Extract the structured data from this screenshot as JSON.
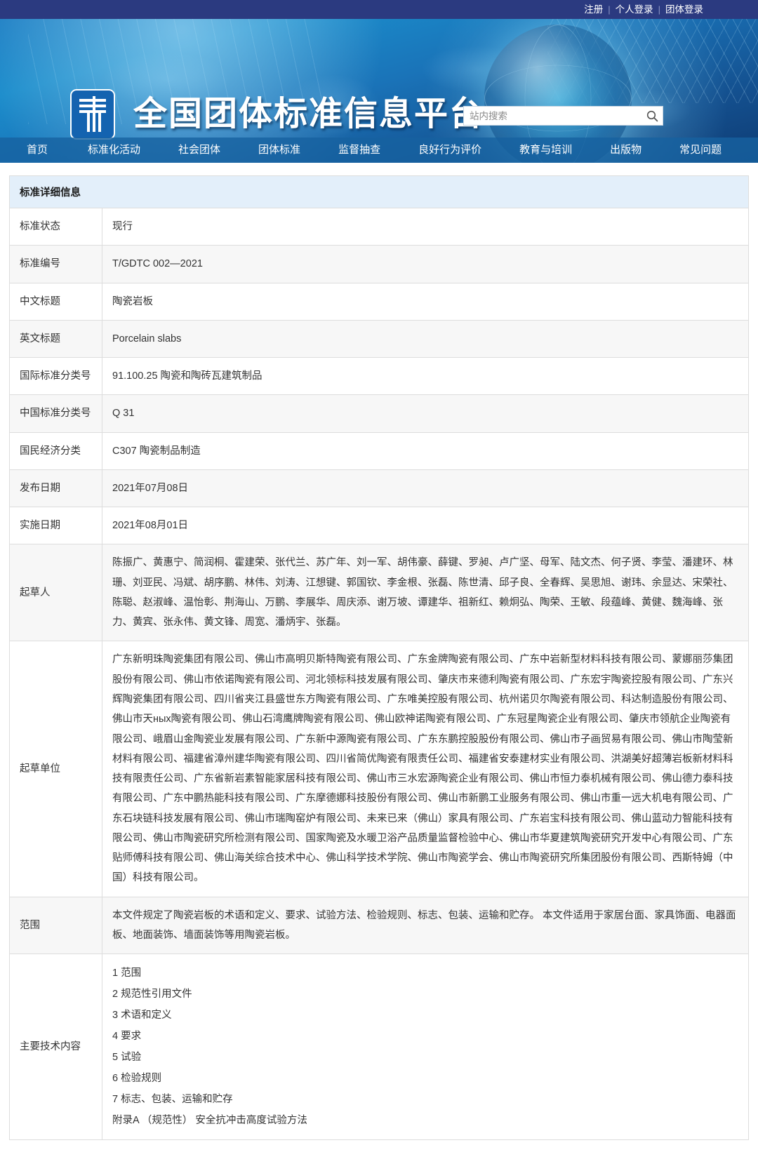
{
  "topbar": {
    "register": "注册",
    "personal_login": "个人登录",
    "group_login": "团体登录",
    "separator": "|"
  },
  "header": {
    "site_title": "全国团体标准信息平台",
    "logo_alt": "平台标识",
    "search": {
      "placeholder": "站内搜索",
      "value": "",
      "button_icon": "search-icon"
    }
  },
  "nav": {
    "items": [
      {
        "label": "首页"
      },
      {
        "label": "标准化活动"
      },
      {
        "label": "社会团体"
      },
      {
        "label": "团体标准"
      },
      {
        "label": "监督抽查"
      },
      {
        "label": "良好行为评价"
      },
      {
        "label": "教育与培训"
      },
      {
        "label": "出版物"
      },
      {
        "label": "常见问题"
      }
    ]
  },
  "detail": {
    "caption": "标准详细信息",
    "rows": [
      {
        "key": "标准状态",
        "value": "现行"
      },
      {
        "key": "标准编号",
        "value": "T/GDTC 002—2021"
      },
      {
        "key": "中文标题",
        "value": "陶瓷岩板"
      },
      {
        "key": "英文标题",
        "value": "Porcelain slabs"
      },
      {
        "key": "国际标准分类号",
        "value": "91.100.25 陶瓷和陶砖瓦建筑制品"
      },
      {
        "key": "中国标准分类号",
        "value": "Q 31"
      },
      {
        "key": "国民经济分类",
        "value": "C307 陶瓷制品制造"
      },
      {
        "key": "发布日期",
        "value": "2021年07月08日"
      },
      {
        "key": "实施日期",
        "value": "2021年08月01日"
      },
      {
        "key": "起草人",
        "value": "陈振广、黄惠宁、简润桐、霍建荣、张代兰、苏广年、刘一军、胡伟豪、薛键、罗昶、卢广坚、母军、陆文杰、何子贤、李莹、潘建环、林珊、刘亚民、冯斌、胡序鹏、林伟、刘涛、江想键、郭国钦、李金根、张磊、陈世清、邱子良、全春辉、吴思旭、谢玮、余显达、宋荣社、陈聪、赵淑峰、温怡彰、荆海山、万鹏、李展华、周庆添、谢万坡、谭建华、祖新红、赖炯弘、陶荣、王敏、段蕴峰、黄健、魏海峰、张力、黄宾、张永伟、黄文锋、周宽、潘炳宇、张磊。"
      },
      {
        "key": "起草单位",
        "value": "广东新明珠陶瓷集团有限公司、佛山市高明贝斯特陶瓷有限公司、广东金牌陶瓷有限公司、广东中岩新型材料科技有限公司、蒙娜丽莎集团股份有限公司、佛山市依诺陶瓷有限公司、河北领标科技发展有限公司、肇庆市来德利陶瓷有限公司、广东宏宇陶瓷控股有限公司、广东兴辉陶瓷集团有限公司、四川省夹江县盛世东方陶瓷有限公司、广东唯美控股有限公司、杭州诺贝尔陶瓷有限公司、科达制造股份有限公司、佛山市天ных陶瓷有限公司、佛山石湾鹰牌陶瓷有限公司、佛山欧神诺陶瓷有限公司、广东冠星陶瓷企业有限公司、肇庆市领航企业陶瓷有限公司、峨眉山金陶瓷业发展有限公司、广东新中源陶瓷有限公司、广东东鹏控股股份有限公司、佛山市子画贸易有限公司、佛山市陶莹新材料有限公司、福建省漳州建华陶瓷有限公司、四川省简优陶瓷有限责任公司、福建省安泰建材实业有限公司、洪湖美好超薄岩板新材料科技有限责任公司、广东省新岩素智能家居科技有限公司、佛山市三水宏源陶瓷企业有限公司、佛山市恒力泰机械有限公司、佛山德力泰科技有限公司、广东中鹏热能科技有限公司、广东摩德娜科技股份有限公司、佛山市新鹏工业服务有限公司、佛山市重一远大机电有限公司、广东石块链科技发展有限公司、佛山市瑞陶窑炉有限公司、未来已来（佛山）家具有限公司、广东岩宝科技有限公司、佛山蓝动力智能科技有限公司、佛山市陶瓷研究所检测有限公司、国家陶瓷及水暖卫浴产品质量监督检验中心、佛山市华夏建筑陶瓷研究开发中心有限公司、广东贴师傅科技有限公司、佛山海关综合技术中心、佛山科学技术学院、佛山市陶瓷学会、佛山市陶瓷研究所集团股份有限公司、西斯特姆（中国）科技有限公司。"
      },
      {
        "key": "范围",
        "value": "本文件规定了陶瓷岩板的术语和定义、要求、试验方法、检验规则、标志、包装、运输和贮存。 本文件适用于家居台面、家具饰面、电器面板、地面装饰、墙面装饰等用陶瓷岩板。"
      }
    ],
    "tech_content": {
      "key": "主要技术内容",
      "lines": [
        "1 范围",
        "2 规范性引用文件",
        "3 术语和定义",
        "4 要求",
        "5 试验",
        "6 检验规则",
        "7 标志、包装、运输和贮存",
        "附录A （规范性） 安全抗冲击高度试验方法"
      ]
    }
  }
}
